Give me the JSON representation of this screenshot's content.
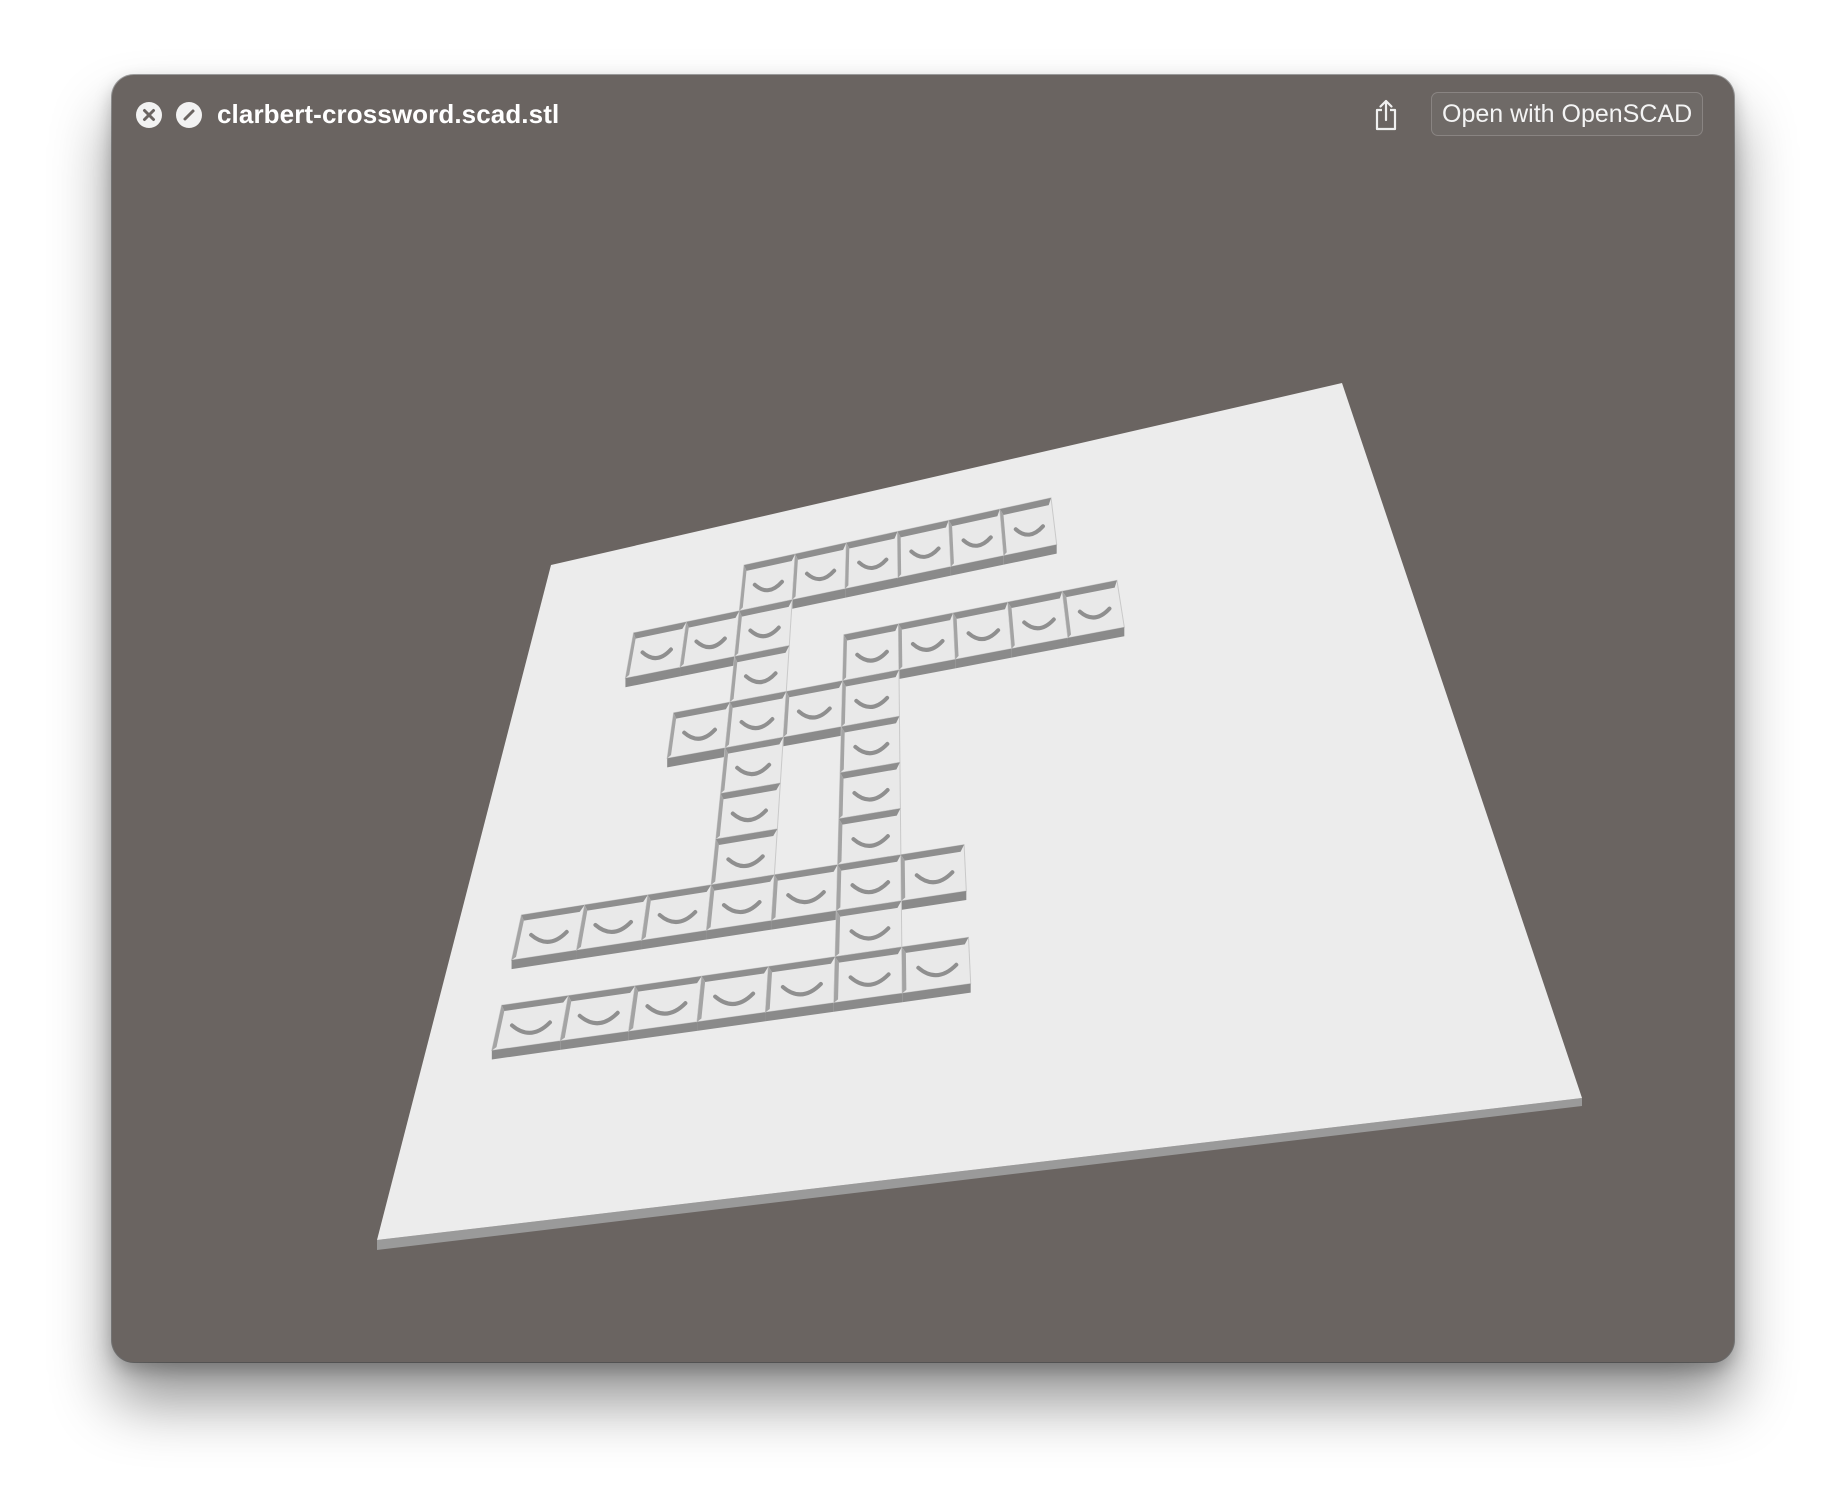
{
  "window": {
    "title": "clarbert-crossword.scad.stl"
  },
  "toolbar": {
    "close_icon": "close-icon",
    "hide_icon": "slash-circle-icon",
    "share_icon": "share-icon",
    "open_with_label": "Open with OpenSCAD"
  },
  "viewer": {
    "model": "crossword grid plate with recessed letter cells",
    "background_color": "#6a6461",
    "plate_color": "#ececec"
  }
}
